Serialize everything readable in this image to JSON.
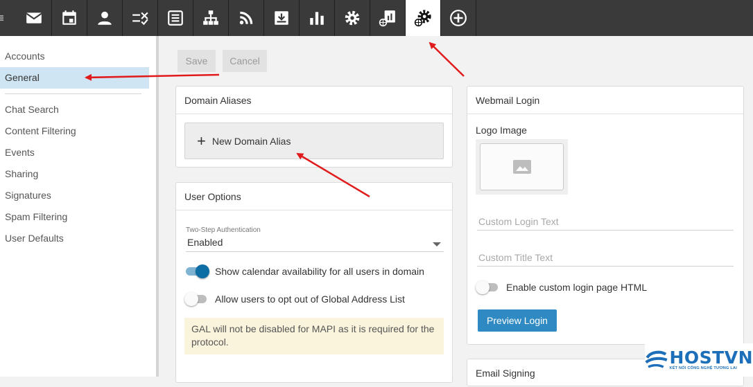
{
  "toolbar": {
    "items": [
      {
        "name": "menu-icon"
      },
      {
        "name": "mail-icon"
      },
      {
        "name": "calendar-icon"
      },
      {
        "name": "contacts-icon"
      },
      {
        "name": "tasks-icon"
      },
      {
        "name": "notes-icon"
      },
      {
        "name": "sitemap-icon"
      },
      {
        "name": "rss-icon"
      },
      {
        "name": "archive-icon"
      },
      {
        "name": "reports-icon"
      },
      {
        "name": "settings-icon"
      },
      {
        "name": "domain-reports-icon"
      },
      {
        "name": "domain-settings-icon",
        "active": true
      },
      {
        "name": "add-icon"
      }
    ]
  },
  "sidebar": {
    "top_items": [
      "Accounts",
      "General"
    ],
    "active": "General",
    "items": [
      "Chat Search",
      "Content Filtering",
      "Events",
      "Sharing",
      "Signatures",
      "Spam Filtering",
      "User Defaults"
    ]
  },
  "actions": {
    "save_label": "Save",
    "cancel_label": "Cancel"
  },
  "domain_aliases": {
    "title": "Domain Aliases",
    "new_label": "New Domain Alias"
  },
  "user_options": {
    "title": "User Options",
    "two_step_label": "Two-Step Authentication",
    "two_step_value": "Enabled",
    "calendar_toggle_label": "Show calendar availability for all users in domain",
    "calendar_toggle_on": true,
    "gal_toggle_label": "Allow users to opt out of Global Address List",
    "gal_toggle_on": false,
    "note": "GAL will not be disabled for MAPI as it is required for the protocol."
  },
  "webmail_login": {
    "title": "Webmail Login",
    "logo_label": "Logo Image",
    "custom_login_placeholder": "Custom Login Text",
    "custom_title_placeholder": "Custom Title Text",
    "custom_html_label": "Enable custom login page HTML",
    "custom_html_on": false,
    "preview_label": "Preview Login"
  },
  "email_signing": {
    "title": "Email Signing"
  },
  "watermark": {
    "brand": "HOSTVN",
    "tagline": "KẾT NỐI CÔNG NGHỆ TƯƠNG LAI"
  },
  "colors": {
    "toolbar": "#3a3a3a",
    "accent": "#2f8ac3",
    "toggle_on": "#0d6ea6",
    "annotation_arrow": "#e11b1b",
    "note_bg": "#fbf4dc"
  }
}
